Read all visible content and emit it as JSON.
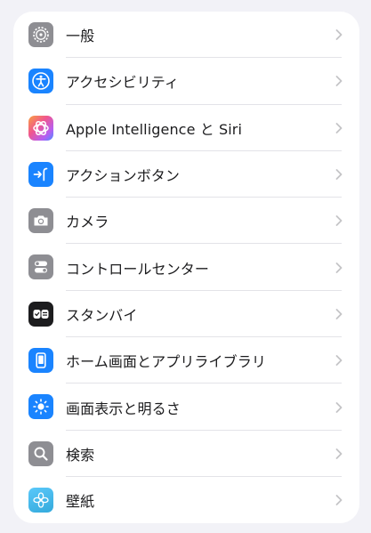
{
  "settings": {
    "items": [
      {
        "id": "general",
        "label": "一般",
        "icon": "gear-icon",
        "color": "#8e8e93"
      },
      {
        "id": "accessibility",
        "label": "アクセシビリティ",
        "icon": "accessibility-icon",
        "color": "#1a84ff"
      },
      {
        "id": "apple-intelligence-siri",
        "label": "Apple Intelligence と Siri",
        "icon": "apple-intelligence-icon",
        "color": "#e96fb0"
      },
      {
        "id": "action-button",
        "label": "アクションボタン",
        "icon": "action-button-icon",
        "color": "#1a84ff"
      },
      {
        "id": "camera",
        "label": "カメラ",
        "icon": "camera-icon",
        "color": "#8e8e93"
      },
      {
        "id": "control-center",
        "label": "コントロールセンター",
        "icon": "control-center-icon",
        "color": "#8e8e93"
      },
      {
        "id": "standby",
        "label": "スタンバイ",
        "icon": "standby-icon",
        "color": "#1c1c1e"
      },
      {
        "id": "home-screen-app-library",
        "label": "ホーム画面とアプリライブラリ",
        "icon": "home-screen-icon",
        "color": "#1a84ff"
      },
      {
        "id": "display-brightness",
        "label": "画面表示と明るさ",
        "icon": "brightness-icon",
        "color": "#1a84ff"
      },
      {
        "id": "search",
        "label": "検索",
        "icon": "search-icon",
        "color": "#8e8e93"
      },
      {
        "id": "wallpaper",
        "label": "壁紙",
        "icon": "wallpaper-icon",
        "color": "#34aadc"
      }
    ]
  }
}
